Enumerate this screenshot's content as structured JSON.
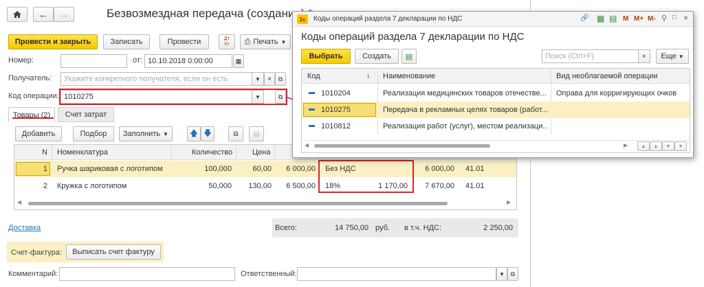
{
  "main": {
    "title": "Безвозмездная передача (создание) *",
    "toolbar": {
      "post_close": "Провести и закрыть",
      "save": "Записать",
      "post": "Провести",
      "dt_kt": "Дт Кт",
      "print": "Печать"
    },
    "fields": {
      "number_label": "Номер:",
      "number_value": "",
      "from_label": "от:",
      "date_value": "10.10.2018  0:00:00",
      "recipient_label": "Получатель:",
      "recipient_placeholder": "Укажите конкретного получателя, если он есть",
      "opcode_label": "Код операции:",
      "opcode_value": "1010275"
    },
    "tabs": [
      "Товары (2)",
      "Счет затрат"
    ],
    "tab_toolbar": {
      "add": "Добавить",
      "select": "Подбор",
      "fill": "Заполнить"
    },
    "table": {
      "headers": [
        "N",
        "Номенклатура",
        "Количество",
        "Цена"
      ],
      "rows": [
        {
          "n": "1",
          "name": "Ручка шариковая с логотипом",
          "qty": "100,000",
          "price": "60,00",
          "sum": "6 000,00",
          "vat_rate": "Без НДС",
          "vat_sum": "",
          "total": "6 000,00",
          "account": "41.01"
        },
        {
          "n": "2",
          "name": "Кружка с логотипом",
          "qty": "50,000",
          "price": "130,00",
          "sum": "6 500,00",
          "vat_rate": "18%",
          "vat_sum": "1 170,00",
          "total": "7 670,00",
          "account": "41.01"
        }
      ]
    },
    "footer": {
      "delivery_link": "Доставка",
      "total_label": "Всего:",
      "total_value": "14 750,00",
      "currency": "руб.",
      "vat_label": "в т.ч. НДС:",
      "vat_value": "2 250,00",
      "invoice_label": "Счет-фактура:",
      "invoice_button": "Выписать счет фактуру",
      "comment_label": "Комментарий:",
      "responsible_label": "Ответственный:"
    }
  },
  "popup": {
    "window_title": "Коды операций раздела 7 декларации по НДС",
    "heading": "Коды операций раздела 7 декларации по НДС",
    "toolbar": {
      "select": "Выбрать",
      "create": "Создать",
      "search_placeholder": "Поиск (Ctrl+F)",
      "more": "Еще"
    },
    "titlebar_icons": [
      "M",
      "M+",
      "M-"
    ],
    "columns": [
      "Код",
      "Наименование",
      "Вид необлагаемой операции"
    ],
    "rows": [
      {
        "code": "1010204",
        "name": "Реализация медицинских товаров отечестве...",
        "kind": "Оправа для корригирующих очков"
      },
      {
        "code": "1010275",
        "name": "Передача в рекламных целях товаров (работ...",
        "kind": ""
      },
      {
        "code": "1010812",
        "name": "Реализация работ (услуг), местом реализаци...",
        "kind": ""
      }
    ]
  },
  "colors": {
    "accent_yellow": "#f5c800",
    "highlight_row": "#fbf0c3",
    "red_annotation": "#d9232e",
    "link": "#2a6ebb"
  }
}
